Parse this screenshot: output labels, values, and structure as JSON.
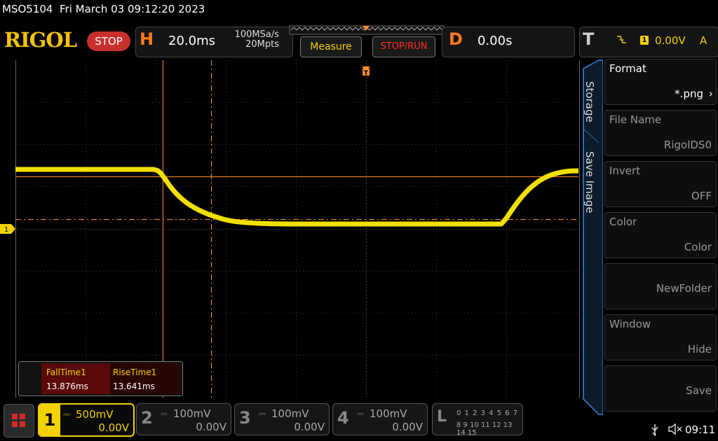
{
  "header": {
    "model": "MSO5104",
    "datetime": "Fri March 03 09:12:20 2023",
    "logo": "RIGOL",
    "run_state": "STOP"
  },
  "horizontal": {
    "letter": "H",
    "timebase": "20.0ms",
    "sample_rate": "100MSa/s",
    "memory_depth": "20Mpts"
  },
  "toolbar": {
    "measure_label": "Measure",
    "stoprun_label": "STOP/RUN"
  },
  "delay": {
    "letter": "D",
    "value": "0.00s"
  },
  "trigger": {
    "letter": "T",
    "edge_icon": "falling-edge-icon",
    "source": "1",
    "level": "0.00V",
    "mode": "A"
  },
  "channel_marker": "1",
  "side_menu": {
    "tabs": [
      "Storage",
      "Save Image"
    ],
    "items": [
      {
        "title": "Format",
        "value": "*.png",
        "active": true
      },
      {
        "title": "File Name",
        "value": "RigolDS0",
        "active": false
      },
      {
        "title": "Invert",
        "value": "OFF",
        "active": false
      },
      {
        "title": "Color",
        "value": "Color",
        "active": false
      },
      {
        "title": "",
        "value": "NewFolder",
        "active": false
      },
      {
        "title": "Window",
        "value": "Hide",
        "active": false
      },
      {
        "title": "",
        "value": "Save",
        "active": false
      }
    ]
  },
  "measurements": [
    {
      "name": "FallTime1",
      "value": "13.876ms"
    },
    {
      "name": "RiseTime1",
      "value": "13.641ms"
    }
  ],
  "channels": [
    {
      "num": "1",
      "scale": "500mV",
      "offset": "0.00V",
      "active": true
    },
    {
      "num": "2",
      "scale": "100mV",
      "offset": "0.00V",
      "active": false
    },
    {
      "num": "3",
      "scale": "100mV",
      "offset": "0.00V",
      "active": false
    },
    {
      "num": "4",
      "scale": "100mV",
      "offset": "0.00V",
      "active": false
    }
  ],
  "logic": {
    "letter": "L",
    "row1": "0 1 2 3  4 5 6 7",
    "row2": "8 9 10 11 12 13 14 15"
  },
  "status": {
    "time": "09:11"
  },
  "colors": {
    "ch1": "#f2d200",
    "cursor": "#ff8c2a",
    "stop": "#c9302c"
  }
}
